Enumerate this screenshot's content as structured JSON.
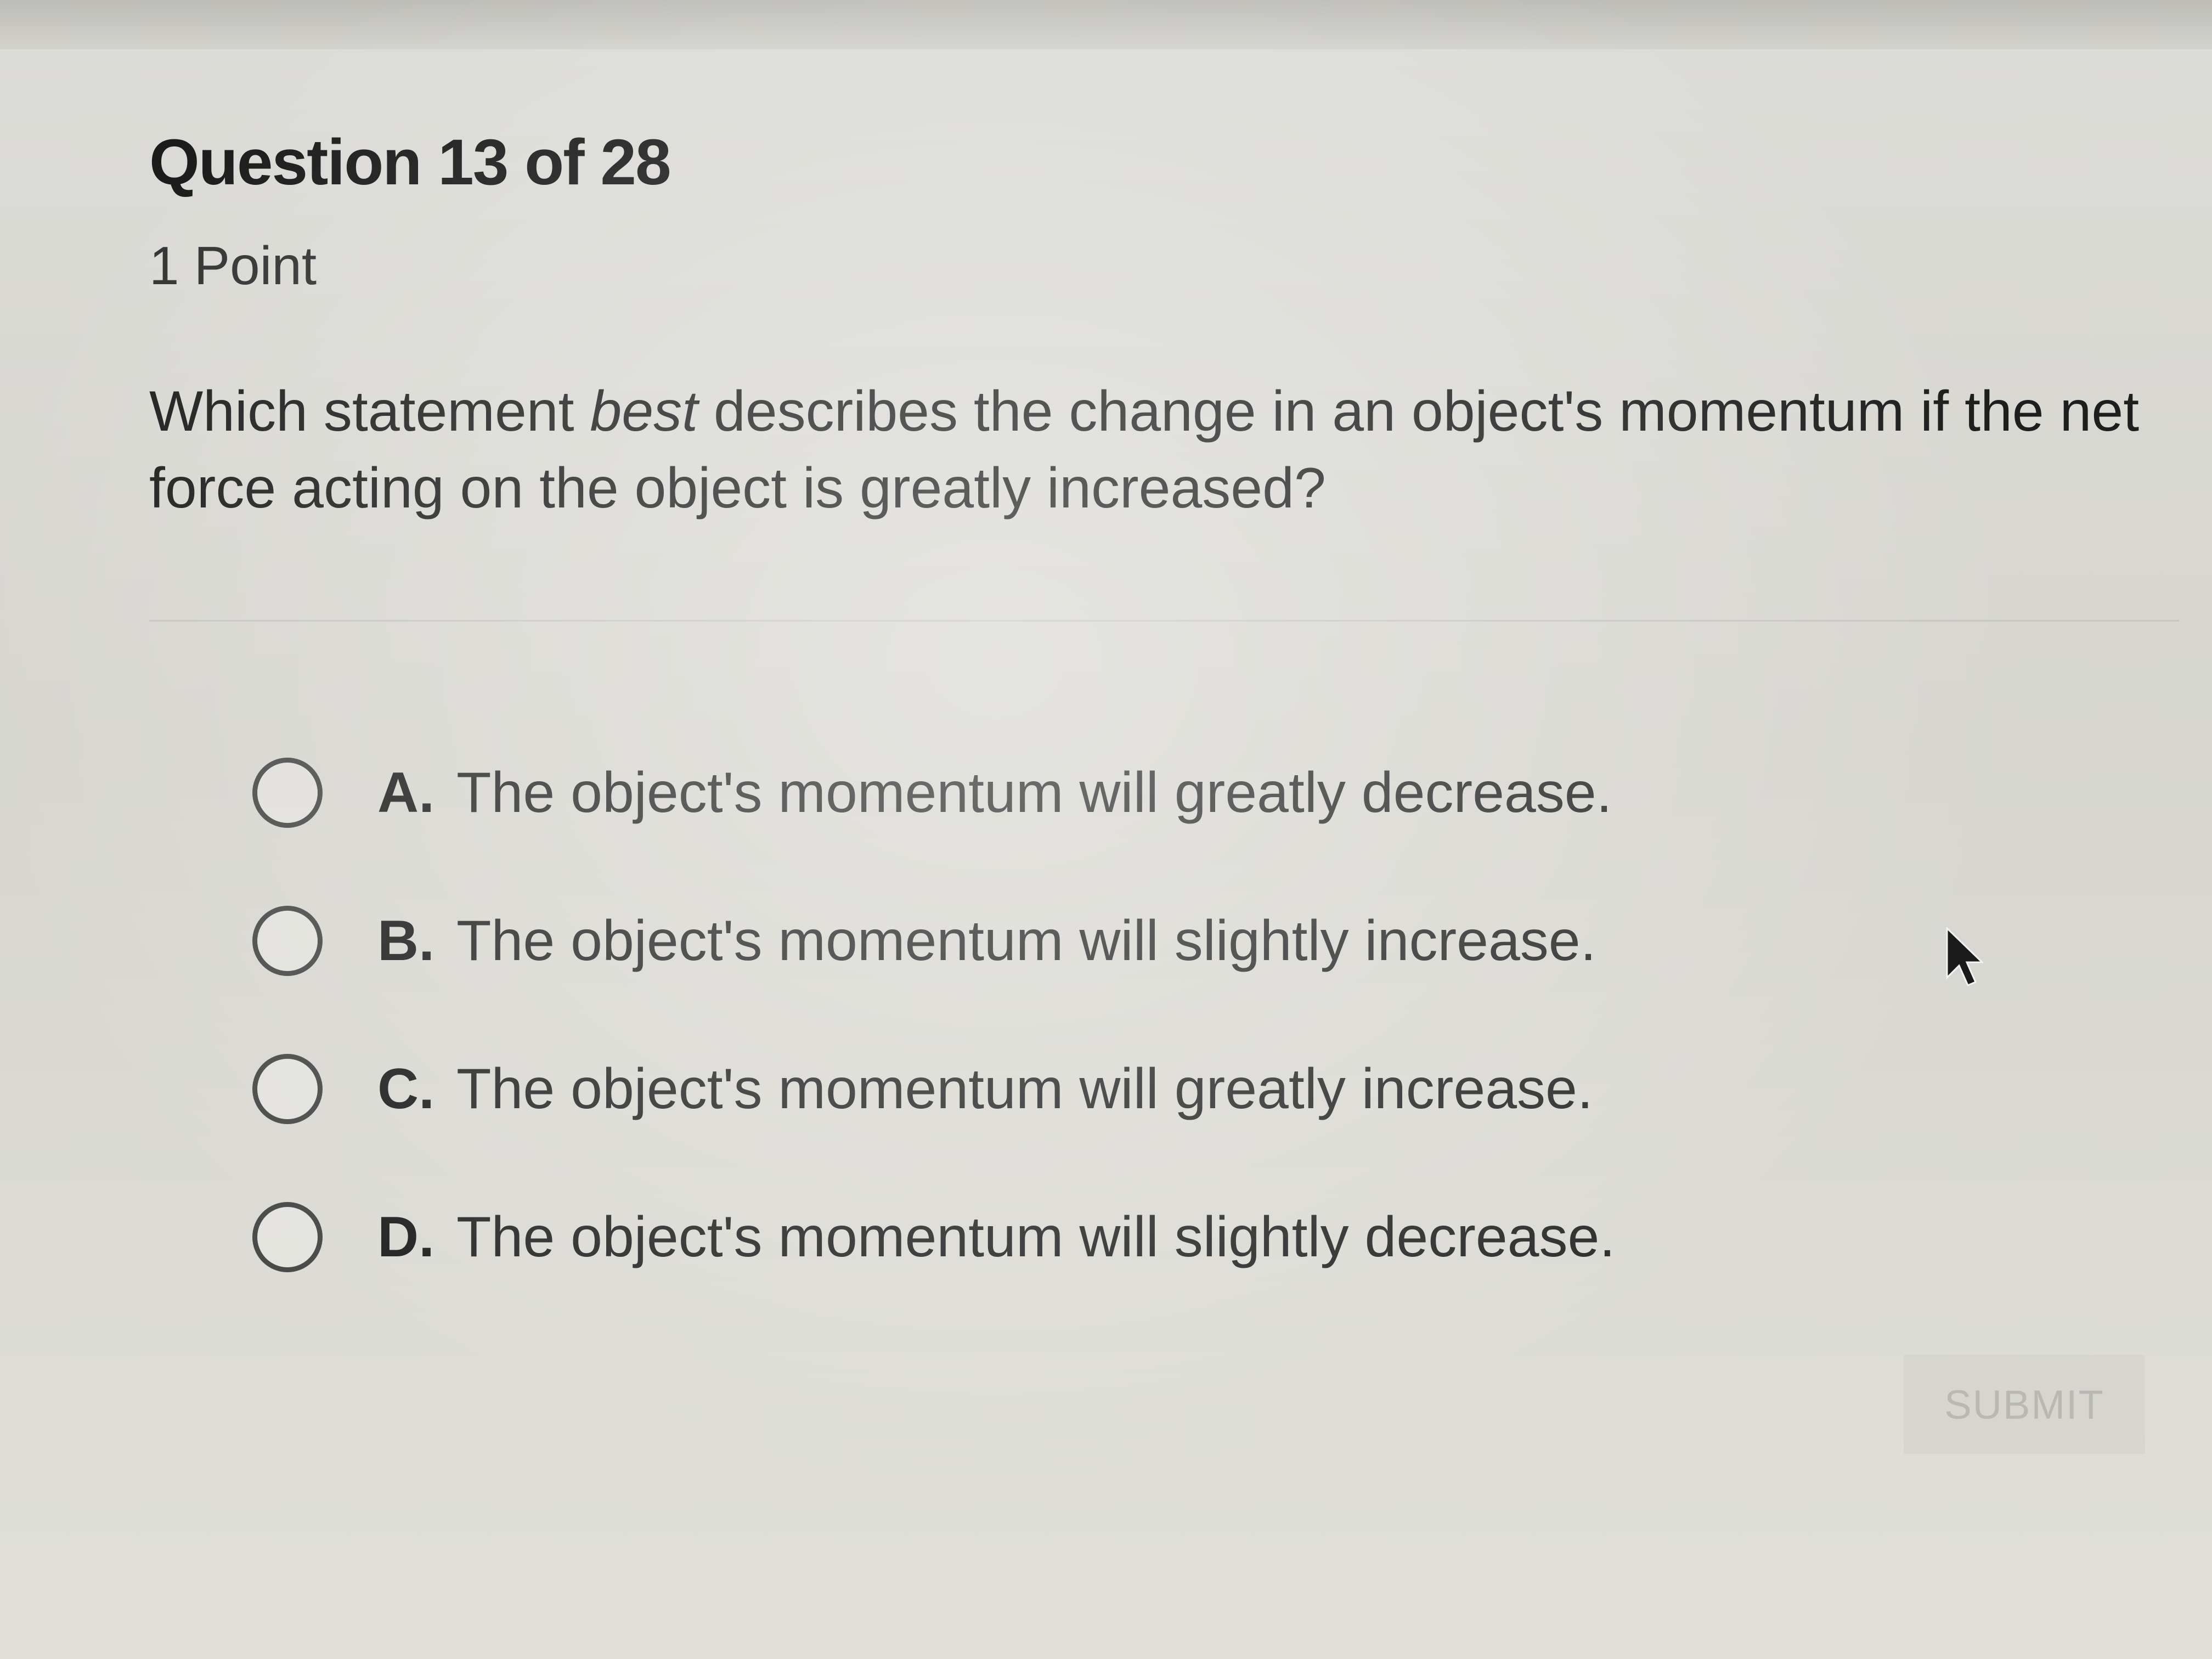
{
  "question": {
    "number_label": "Question 13 of 28",
    "points_label": "1 Point",
    "prompt_before": "Which statement ",
    "prompt_emphasis": "best",
    "prompt_after": " describes the change in an object's momentum if the net force acting on the object is greatly increased?"
  },
  "options": [
    {
      "letter": "A.",
      "text": "The object's momentum will greatly decrease."
    },
    {
      "letter": "B.",
      "text": "The object's momentum will slightly increase."
    },
    {
      "letter": "C.",
      "text": "The object's momentum will greatly increase."
    },
    {
      "letter": "D.",
      "text": "The object's momentum will slightly decrease."
    }
  ],
  "submit": {
    "label": "SUBMIT"
  },
  "icons": {
    "cursor": "mouse-pointer-icon",
    "radio": "radio-button-icon"
  }
}
